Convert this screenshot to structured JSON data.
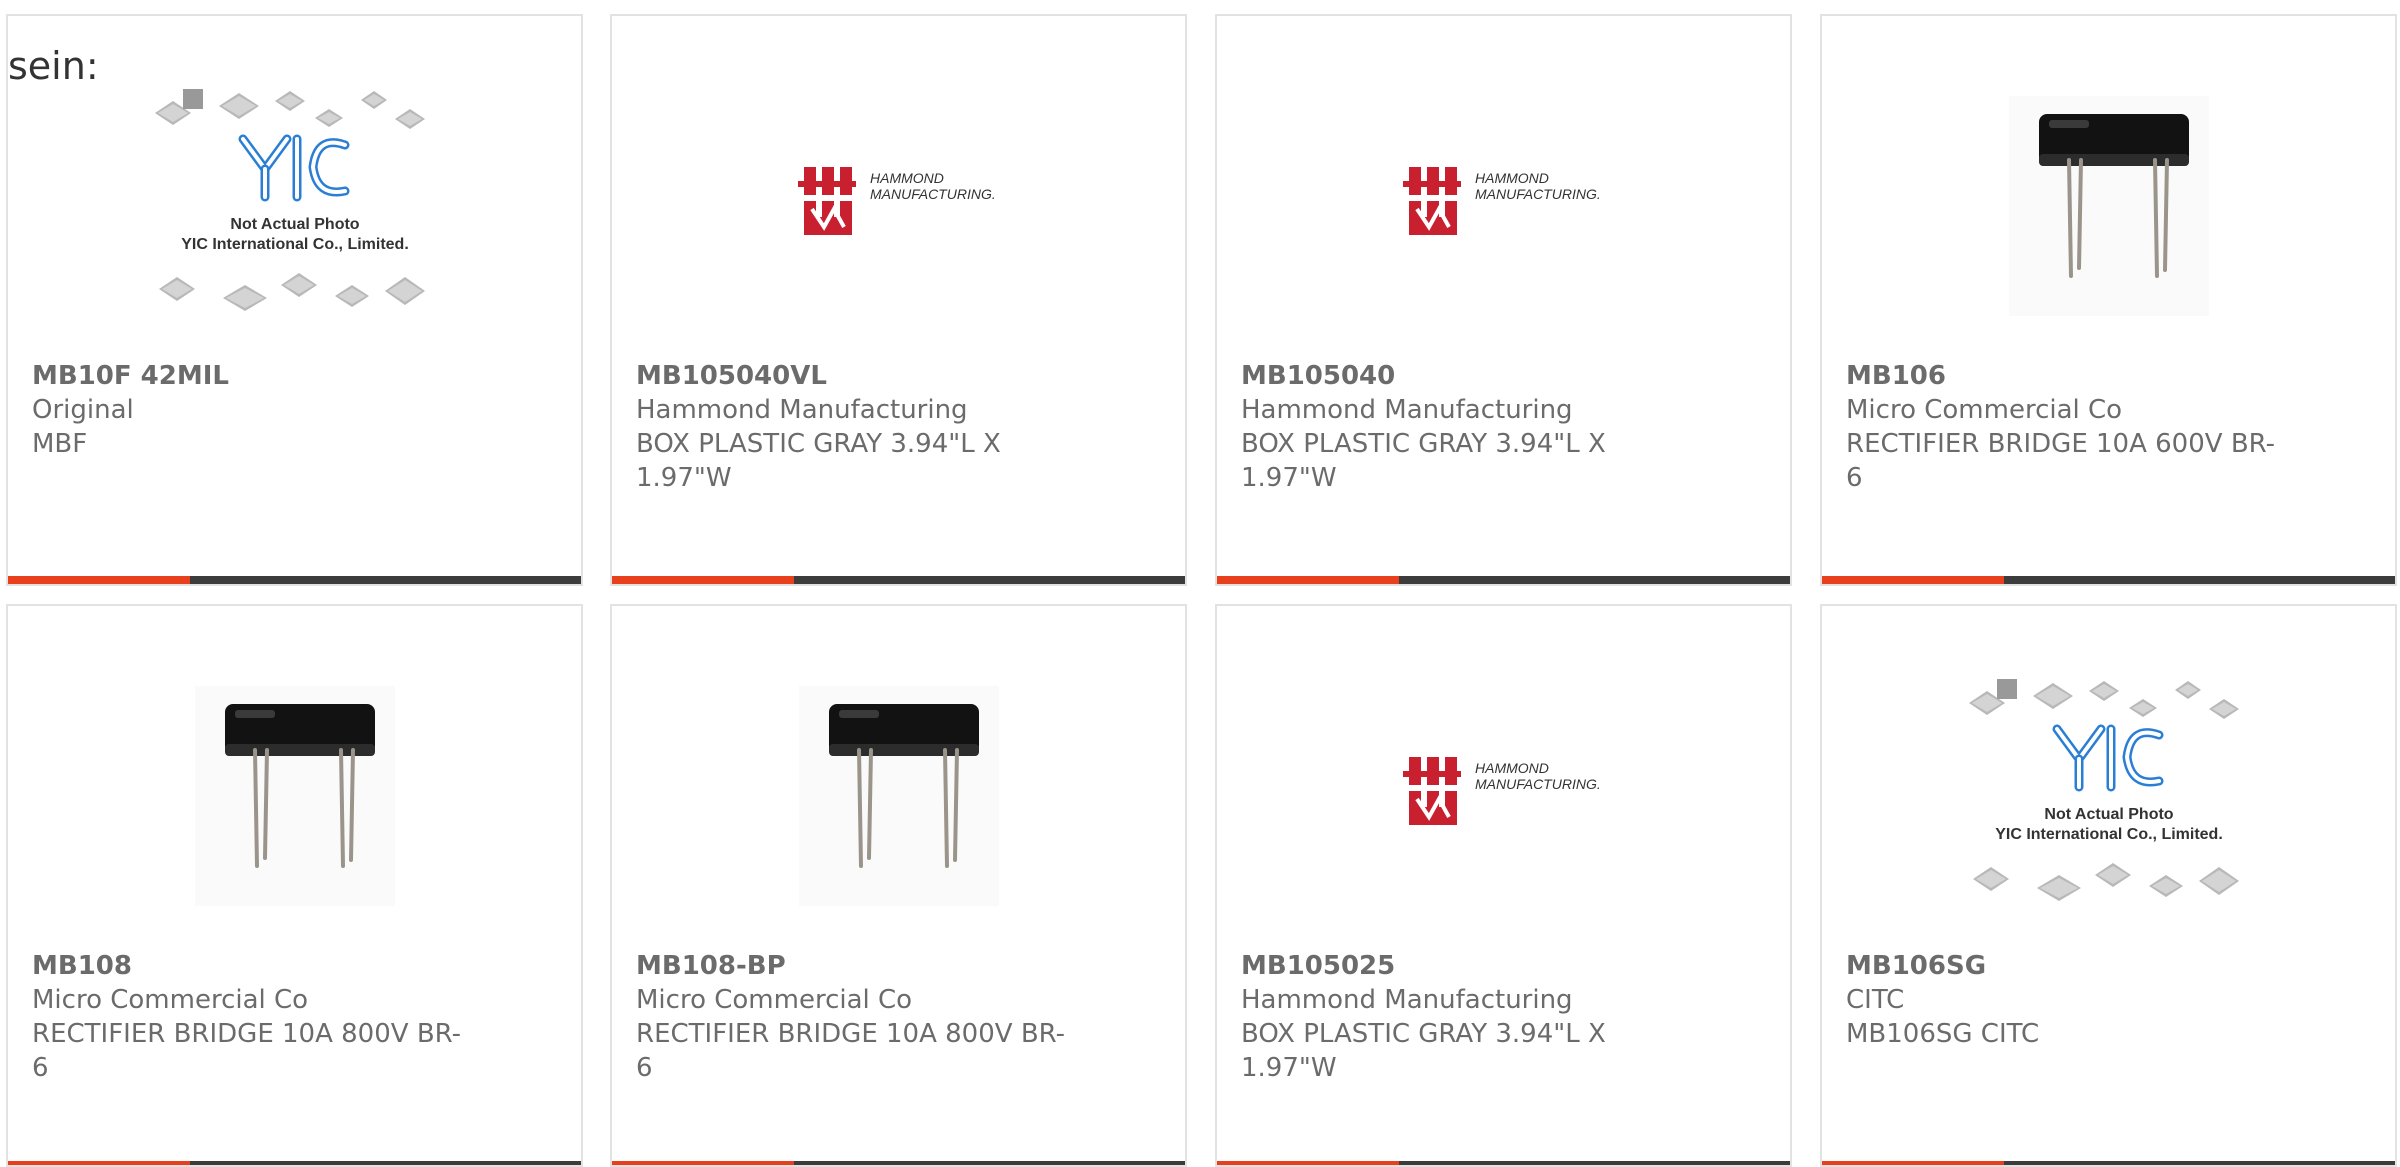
{
  "lead_text": "sein:",
  "colors": {
    "accent": "#e8401c",
    "bar": "#3c3c3c",
    "text": "#6b6b6b",
    "border": "#e2e2e2"
  },
  "products": [
    {
      "part": "MB10F 42MIL",
      "maker": "Original",
      "desc": "MBF",
      "image": "yic-placeholder",
      "placeholder_text": [
        "Not Actual Photo",
        "YIC International Co., Limited."
      ]
    },
    {
      "part": "MB105040VL",
      "maker": "Hammond Manufacturing",
      "desc": "BOX PLASTIC GRAY 3.94\"L X 1.97\"W",
      "image": "hammond-logo",
      "logo_text": [
        "HAMMOND",
        "MANUFACTURING."
      ]
    },
    {
      "part": "MB105040",
      "maker": "Hammond Manufacturing",
      "desc": "BOX PLASTIC GRAY 3.94\"L X 1.97\"W",
      "image": "hammond-logo",
      "logo_text": [
        "HAMMOND",
        "MANUFACTURING."
      ]
    },
    {
      "part": "MB106",
      "maker": "Micro Commercial Co",
      "desc": "RECTIFIER BRIDGE 10A 600V BR-6",
      "image": "bridge-rectifier-photo"
    },
    {
      "part": "MB108",
      "maker": "Micro Commercial Co",
      "desc": "RECTIFIER BRIDGE 10A 800V BR-6",
      "image": "bridge-rectifier-photo"
    },
    {
      "part": "MB108-BP",
      "maker": "Micro Commercial Co",
      "desc": "RECTIFIER BRIDGE 10A 800V BR-6",
      "image": "bridge-rectifier-photo"
    },
    {
      "part": "MB105025",
      "maker": "Hammond Manufacturing",
      "desc": "BOX PLASTIC GRAY 3.94\"L X 1.97\"W",
      "image": "hammond-logo",
      "logo_text": [
        "HAMMOND",
        "MANUFACTURING."
      ]
    },
    {
      "part": "MB106SG",
      "maker": "CITC",
      "desc": "MB106SG CITC",
      "image": "yic-placeholder",
      "placeholder_text": [
        "Not Actual Photo",
        "YIC International Co., Limited."
      ]
    }
  ]
}
